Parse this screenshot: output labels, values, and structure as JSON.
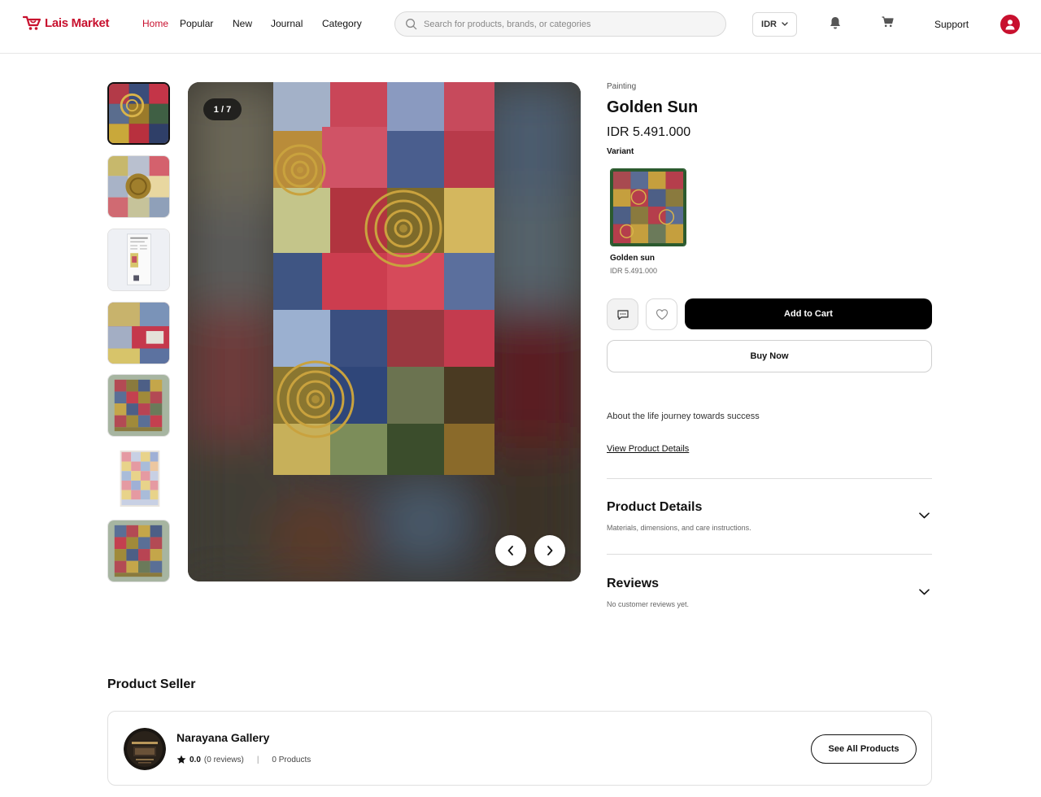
{
  "header": {
    "logo_text": "Lais Market",
    "nav": [
      {
        "label": "Home",
        "active": true
      },
      {
        "label": "Popular"
      },
      {
        "label": "New"
      },
      {
        "label": "Journal"
      },
      {
        "label": "Category"
      }
    ],
    "search_placeholder": "Search for products, brands, or categories",
    "currency": "IDR",
    "support_label": "Support",
    "icons": [
      "bell-icon",
      "cart-icon",
      "user-icon"
    ],
    "accent_color": "#c8102e"
  },
  "gallery": {
    "counter": "1 / 7",
    "thumbnail_count": 7,
    "selected_index": 0
  },
  "product": {
    "category": "Painting",
    "title": "Golden Sun",
    "price": "IDR 5.491.000",
    "variant_label": "Variant",
    "variant": {
      "name": "Golden sun",
      "price": "IDR 5.491.000"
    },
    "add_to_cart_label": "Add to Cart",
    "buy_now_label": "Buy Now",
    "description": "About the life journey towards success",
    "view_details_label": "View Product Details"
  },
  "accordions": {
    "details": {
      "title": "Product Details",
      "subtitle": "Materials, dimensions, and care instructions."
    },
    "reviews": {
      "title": "Reviews",
      "subtitle": "No customer reviews yet."
    }
  },
  "seller": {
    "heading": "Product Seller",
    "name": "Narayana Gallery",
    "rating": "0.0",
    "reviews": "(0 reviews)",
    "products": "0 Products",
    "see_all_label": "See All Products"
  }
}
